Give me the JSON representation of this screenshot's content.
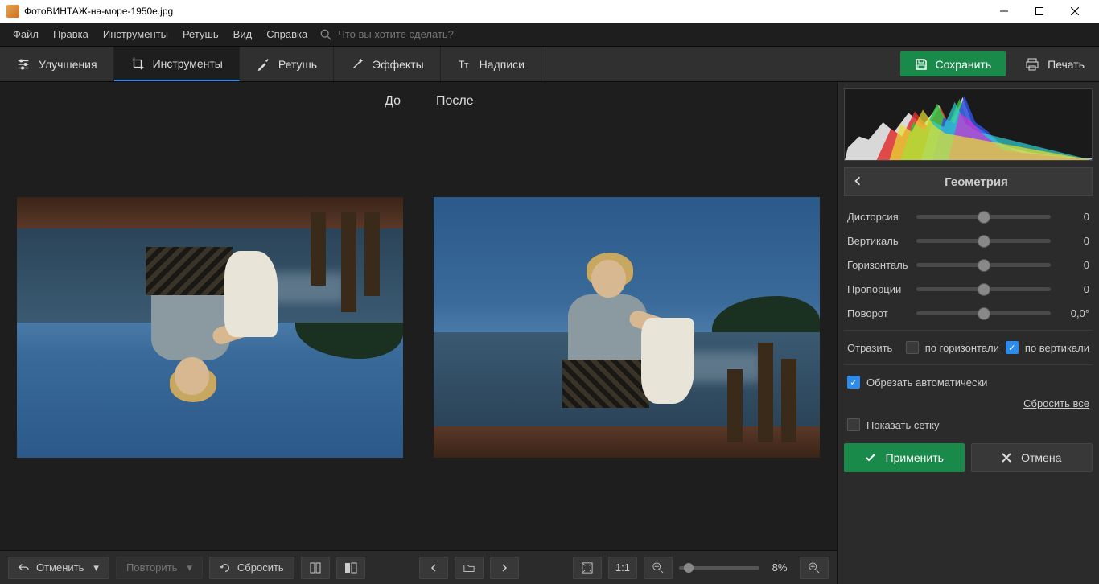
{
  "titlebar": {
    "app": "ФотоВИНТАЖ",
    "sep": " - ",
    "file": "на-море-1950е.jpg"
  },
  "menu": {
    "file": "Файл",
    "edit": "Правка",
    "tools": "Инструменты",
    "retouch": "Ретушь",
    "view": "Вид",
    "help": "Справка",
    "search_placeholder": "Что вы хотите сделать?"
  },
  "tabs": {
    "enhance": "Улучшения",
    "tools": "Инструменты",
    "retouch": "Ретушь",
    "effects": "Эффекты",
    "captions": "Надписи"
  },
  "actions": {
    "save": "Сохранить",
    "print": "Печать"
  },
  "views": {
    "before": "До",
    "after": "После"
  },
  "bottom": {
    "undo": "Отменить",
    "redo": "Повторить",
    "reset": "Сбросить",
    "zoom_ratio": "1:1",
    "zoom_pct": "8%"
  },
  "panel": {
    "title": "Геометрия",
    "sliders": {
      "distortion": {
        "label": "Дисторсия",
        "value": "0"
      },
      "vertical": {
        "label": "Вертикаль",
        "value": "0"
      },
      "horizontal": {
        "label": "Горизонталь",
        "value": "0"
      },
      "proportions": {
        "label": "Пропорции",
        "value": "0"
      },
      "rotate": {
        "label": "Поворот",
        "value": "0,0°"
      }
    },
    "flip": {
      "label": "Отразить",
      "h": "по горизонтали",
      "v": "по вертикали",
      "h_on": false,
      "v_on": true
    },
    "autocrop": {
      "label": "Обрезать автоматически",
      "on": true
    },
    "grid": {
      "label": "Показать сетку",
      "on": false
    },
    "reset_all": "Сбросить все",
    "apply": "Применить",
    "cancel": "Отмена"
  }
}
